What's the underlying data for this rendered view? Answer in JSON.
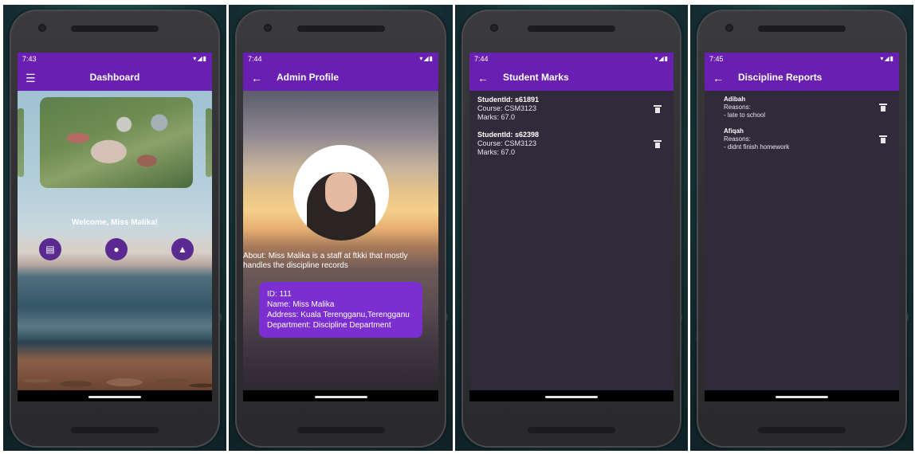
{
  "screens": [
    {
      "status_time": "7:43",
      "title": "Dashboard",
      "nav_icon": "menu-icon",
      "welcome": "Welcome, Miss Malika!",
      "buttons": [
        {
          "icon": "clipboard-icon",
          "glyph": "▤"
        },
        {
          "icon": "account-circle-icon",
          "glyph": "●"
        },
        {
          "icon": "warning-icon",
          "glyph": "▲"
        }
      ]
    },
    {
      "status_time": "7:44",
      "title": "Admin Profile",
      "nav_icon": "back-arrow-icon",
      "about": "About: Miss Malika is a staff at ftkki that mostly handles the discipline records",
      "card": {
        "id": "ID: 111",
        "name": "Name: Miss Malika",
        "address": "Address: Kuala Terengganu,Terengganu",
        "department": "Department: Discipline Department"
      }
    },
    {
      "status_time": "7:44",
      "title": "Student Marks",
      "nav_icon": "back-arrow-icon",
      "items": [
        {
          "student_id": "StudentId: s61891",
          "course": "Course: CSM3123",
          "marks": "Marks: 67.0"
        },
        {
          "student_id": "StudentId: s62398",
          "course": "Course: CSM3123",
          "marks": "Marks: 67.0"
        }
      ]
    },
    {
      "status_time": "7:45",
      "title": "Discipline Reports",
      "nav_icon": "back-arrow-icon",
      "items": [
        {
          "name": "Adibah",
          "reasons_label": "Reasons:",
          "reason": "- late to school"
        },
        {
          "name": "Afiqah",
          "reasons_label": "Reasons:",
          "reason": "- didnt finish homework"
        }
      ]
    }
  ],
  "colors": {
    "primary": "#6a1fb3",
    "card": "#7b2fd0",
    "screen_bg": "#302a3a",
    "icon_button": "#5a2a91"
  }
}
